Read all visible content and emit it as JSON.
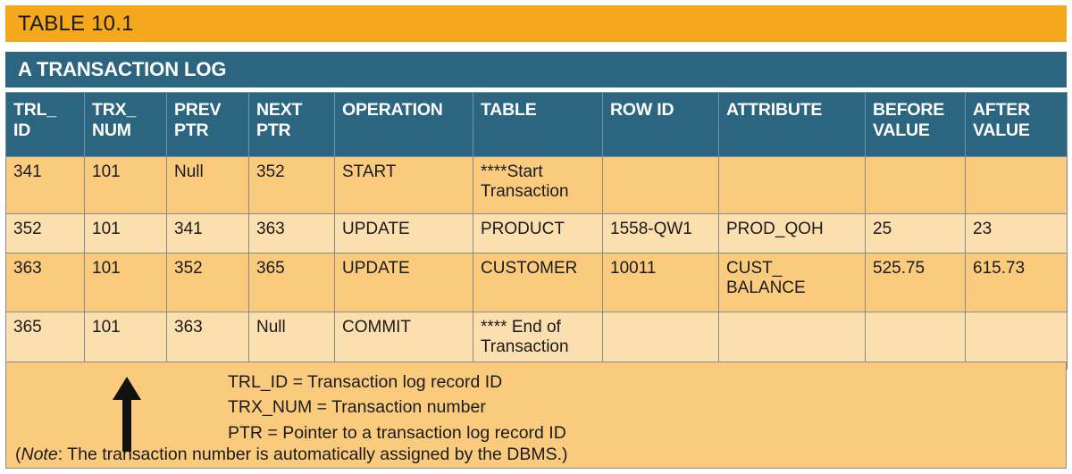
{
  "title": {
    "label": "TABLE 10.1"
  },
  "subtitle": {
    "label": "A TRANSACTION LOG"
  },
  "colors": {
    "title_bar": "#F5A81C",
    "banner": "#2B6580",
    "row_dark": "#FBCB7D",
    "row_light": "#FCDFAE",
    "border": "#8a8a8a",
    "text": "#1a1a1a"
  },
  "table": {
    "headers": [
      {
        "line1": "TRL_",
        "line2": "ID"
      },
      {
        "line1": "TRX_",
        "line2": "NUM"
      },
      {
        "line1": "PREV",
        "line2": "PTR"
      },
      {
        "line1": "NEXT",
        "line2": "PTR"
      },
      {
        "line1": "OPERATION",
        "line2": ""
      },
      {
        "line1": "TABLE",
        "line2": ""
      },
      {
        "line1": "ROW ID",
        "line2": ""
      },
      {
        "line1": "ATTRIBUTE",
        "line2": ""
      },
      {
        "line1": "BEFORE",
        "line2": "VALUE"
      },
      {
        "line1": "AFTER",
        "line2": "VALUE"
      }
    ],
    "rows": [
      {
        "trl_id": "341",
        "trx_num": "101",
        "prev_ptr": "Null",
        "next_ptr": "352",
        "operation": "START",
        "table_line1": "****Start",
        "table_line2": "Transaction",
        "row_id": "",
        "attribute_line1": "",
        "attribute_line2": "",
        "before_value": "",
        "after_value": ""
      },
      {
        "trl_id": "352",
        "trx_num": "101",
        "prev_ptr": "341",
        "next_ptr": "363",
        "operation": "UPDATE",
        "table_line1": "PRODUCT",
        "table_line2": "",
        "row_id": "1558-QW1",
        "attribute_line1": "PROD_QOH",
        "attribute_line2": "",
        "before_value": "25",
        "after_value": "23"
      },
      {
        "trl_id": "363",
        "trx_num": "101",
        "prev_ptr": "352",
        "next_ptr": "365",
        "operation": "UPDATE",
        "table_line1": "CUSTOMER",
        "table_line2": "",
        "row_id": "10011",
        "attribute_line1": "CUST_",
        "attribute_line2": "BALANCE",
        "before_value": "525.75",
        "after_value": "615.73"
      },
      {
        "trl_id": "365",
        "trx_num": "101",
        "prev_ptr": "363",
        "next_ptr": "Null",
        "operation": "COMMIT",
        "table_line1": "**** End of",
        "table_line2": "Transaction",
        "row_id": "",
        "attribute_line1": "",
        "attribute_line2": "",
        "before_value": "",
        "after_value": ""
      }
    ]
  },
  "footer": {
    "legend": [
      "TRL_ID = Transaction log record ID",
      "TRX_NUM = Transaction number",
      "PTR = Pointer to a transaction log record ID"
    ],
    "note_prefix": "(",
    "note_italic": "Note",
    "note_text": ": The transaction number is automatically assigned by the DBMS.)"
  }
}
